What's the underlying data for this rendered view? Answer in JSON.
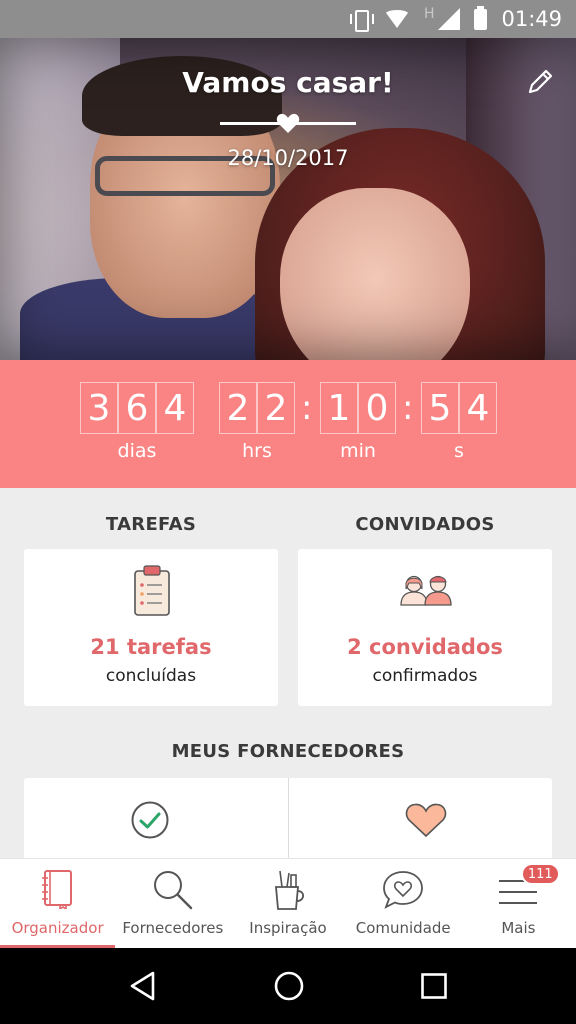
{
  "status_bar": {
    "time": "01:49",
    "network_label": "H"
  },
  "hero": {
    "title": "Vamos casar!",
    "date": "28/10/2017"
  },
  "countdown": {
    "days_digits": [
      "3",
      "6",
      "4"
    ],
    "hours_digits": [
      "2",
      "2"
    ],
    "minutes_digits": [
      "1",
      "0"
    ],
    "seconds_digits": [
      "5",
      "4"
    ],
    "separator": ":",
    "days_label": "dias",
    "hours_label": "hrs",
    "minutes_label": "min",
    "seconds_label": "s"
  },
  "tasks": {
    "title": "TAREFAS",
    "count": "21 tarefas",
    "subtitle": "concluídas"
  },
  "guests": {
    "title": "CONVIDADOS",
    "count": "2 convidados",
    "subtitle": "confirmados"
  },
  "vendors": {
    "title": "MEUS FORNECEDORES"
  },
  "bottom_nav": {
    "items": [
      {
        "label": "Organizador",
        "icon": "notebook-icon"
      },
      {
        "label": "Fornecedores",
        "icon": "search-icon"
      },
      {
        "label": "Inspiração",
        "icon": "pencil-cup-icon"
      },
      {
        "label": "Comunidade",
        "icon": "chat-heart-icon"
      },
      {
        "label": "Mais",
        "icon": "menu-icon"
      }
    ],
    "badge": "111"
  },
  "colors": {
    "accent": "#fa8484",
    "accent_text": "#e0676a",
    "background": "#ededed"
  }
}
